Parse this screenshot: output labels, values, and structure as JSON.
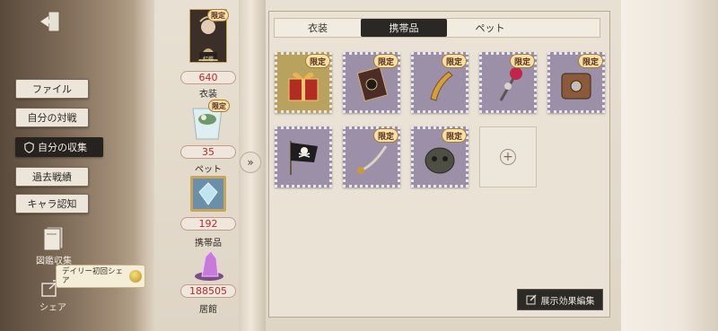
{
  "nav": {
    "buttons": [
      "ファイル",
      "自分の対戦",
      "自分の収集",
      "過去戦績",
      "キャラ認知"
    ],
    "active_index": 2,
    "side_items": {
      "illustrated": "図鑑収集",
      "share": "シェア"
    },
    "tooltip": "デイリー初回シェア"
  },
  "stats": [
    {
      "value": "640",
      "label": "衣装"
    },
    {
      "value": "35",
      "label": "ペット"
    },
    {
      "value": "192",
      "label": "携帯品"
    },
    {
      "value": "188505",
      "label": "居館"
    }
  ],
  "avatar_badge": "限定",
  "avatar_caption": "紅蝶",
  "tabs": [
    "衣装",
    "携帯品",
    "ペット"
  ],
  "active_tab": 1,
  "items": [
    {
      "icon": "gift-box-icon",
      "badge": "限定"
    },
    {
      "icon": "book-icon",
      "badge": "限定"
    },
    {
      "icon": "golden-horn-icon",
      "badge": "限定"
    },
    {
      "icon": "rose-scepter-icon",
      "badge": "限定"
    },
    {
      "icon": "leather-case-icon",
      "badge": "限定"
    },
    {
      "icon": "pirate-flag-icon",
      "badge": ""
    },
    {
      "icon": "sabre-icon",
      "badge": "限定"
    },
    {
      "icon": "stone-mask-icon",
      "badge": "限定"
    }
  ],
  "edit_button": "展示効果編集",
  "colors": {
    "accent_red": "#b02c2c",
    "tab_active": "#2a2724",
    "stamp": "#9c8fa8"
  }
}
